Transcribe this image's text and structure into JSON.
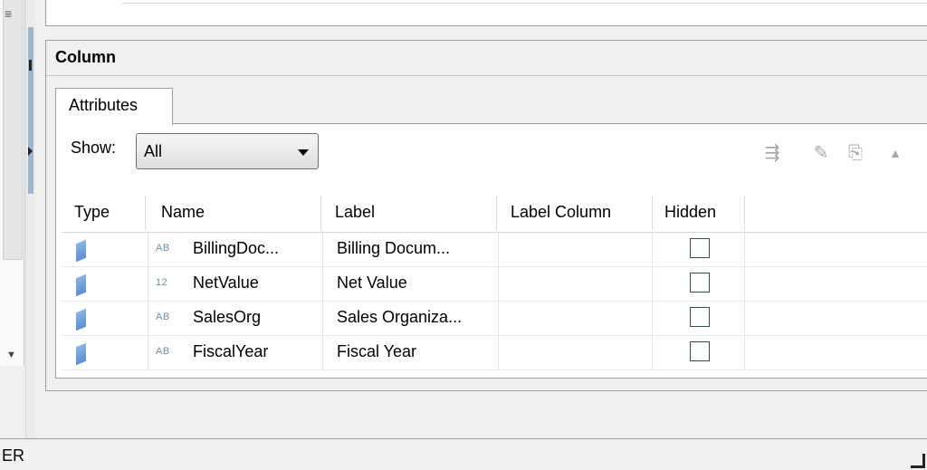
{
  "panel": {
    "title": "Column"
  },
  "tabs": [
    {
      "label": "Attributes"
    }
  ],
  "filter": {
    "label": "Show:",
    "value": "All"
  },
  "toolbar": {
    "icons": [
      "add-row-icon",
      "edit-icon",
      "import-icon",
      "collapse-up-icon"
    ]
  },
  "table": {
    "columns": [
      "Type",
      "Name",
      "Label",
      "Label Column",
      "Hidden"
    ],
    "rows": [
      {
        "datatype": "AB",
        "name": "BillingDoc...",
        "label": "Billing Docum...",
        "label_column": "",
        "hidden": false
      },
      {
        "datatype": "12",
        "name": "NetValue",
        "label": "Net Value",
        "label_column": "",
        "hidden": false
      },
      {
        "datatype": "AB",
        "name": "SalesOrg",
        "label": "Sales Organiza...",
        "label_column": "",
        "hidden": false
      },
      {
        "datatype": "AB",
        "name": "FiscalYear",
        "label": "Fiscal Year",
        "label_column": "",
        "hidden": false
      }
    ]
  },
  "status": {
    "text": "ER"
  },
  "colors": {
    "type_icon": "#6f9fdc",
    "datatype_text": "#6a8fb0",
    "border": "#a0a0a0"
  }
}
